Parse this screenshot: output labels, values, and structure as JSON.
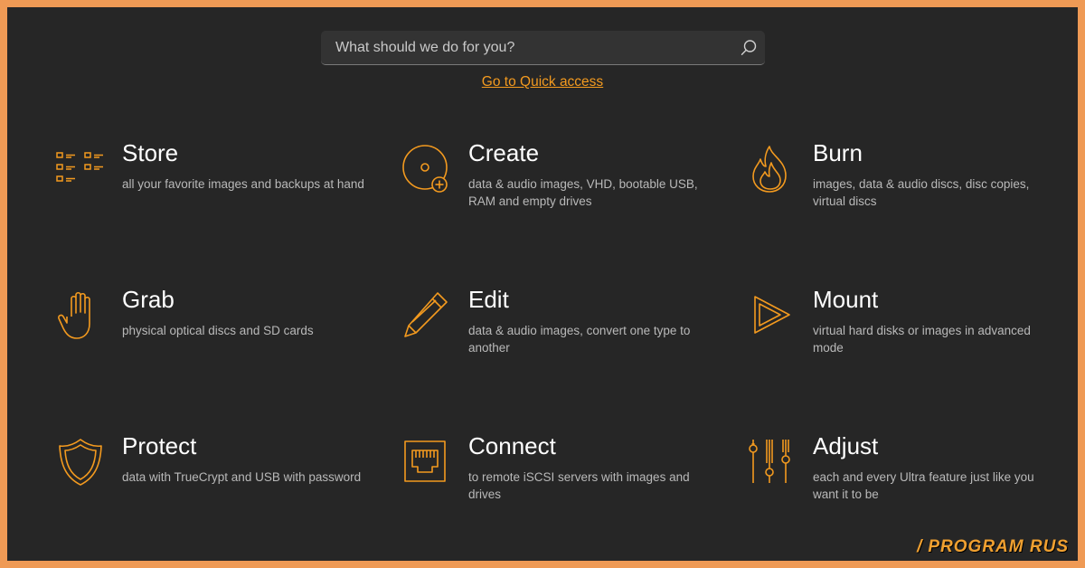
{
  "search": {
    "placeholder": "What should we do for you?"
  },
  "quick_access": {
    "label": "Go to Quick access"
  },
  "accent": "#f39a1f",
  "tiles": [
    {
      "title": "Store",
      "desc": "all your favorite images and backups at hand",
      "icon": "store-list-icon"
    },
    {
      "title": "Create",
      "desc": "data & audio images, VHD, bootable USB, RAM and empty drives",
      "icon": "disc-plus-icon"
    },
    {
      "title": "Burn",
      "desc": "images, data & audio discs, disc copies, virtual discs",
      "icon": "flame-icon"
    },
    {
      "title": "Grab",
      "desc": "physical optical discs and SD cards",
      "icon": "hand-icon"
    },
    {
      "title": "Edit",
      "desc": "data & audio images, convert one type to another",
      "icon": "pencil-icon"
    },
    {
      "title": "Mount",
      "desc": "virtual hard disks or images in advanced mode",
      "icon": "play-triangle-icon"
    },
    {
      "title": "Protect",
      "desc": "data with TrueCrypt and USB with password",
      "icon": "shield-icon"
    },
    {
      "title": "Connect",
      "desc": "to remote iSCSI servers with images and drives",
      "icon": "network-port-icon"
    },
    {
      "title": "Adjust",
      "desc": "each and every Ultra feature just like you want it to be",
      "icon": "sliders-icon"
    }
  ],
  "watermark": {
    "slash": "/",
    "text": "PROGRAM RUS"
  }
}
